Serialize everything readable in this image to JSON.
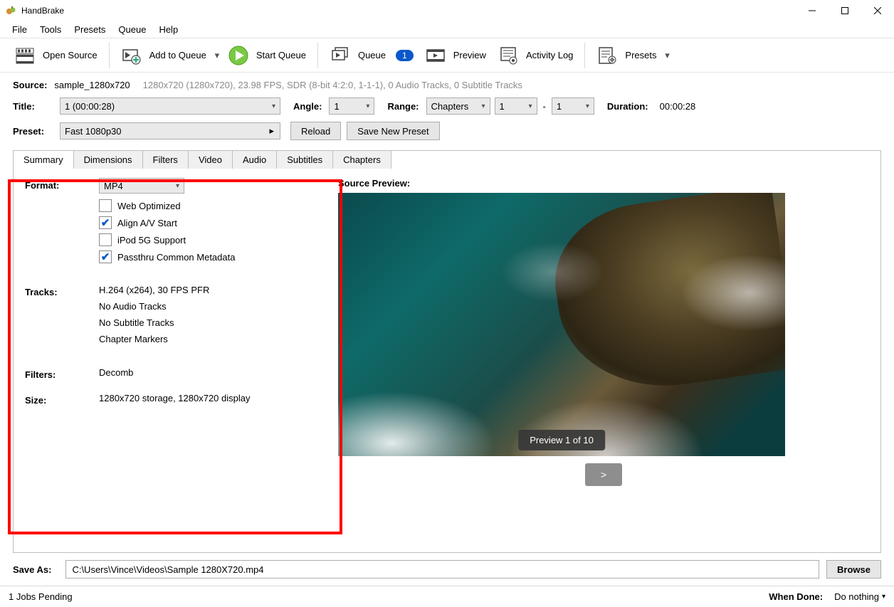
{
  "window": {
    "title": "HandBrake"
  },
  "menu": {
    "file": "File",
    "tools": "Tools",
    "presets": "Presets",
    "queue": "Queue",
    "help": "Help"
  },
  "toolbar": {
    "open_source": "Open Source",
    "add_to_queue": "Add to Queue",
    "start_queue": "Start Queue",
    "queue": "Queue",
    "queue_count": "1",
    "preview": "Preview",
    "activity_log": "Activity Log",
    "presets": "Presets"
  },
  "source": {
    "label": "Source:",
    "name": "sample_1280x720",
    "details": "1280x720 (1280x720), 23.98 FPS, SDR (8-bit 4:2:0, 1-1-1), 0 Audio Tracks, 0 Subtitle Tracks"
  },
  "title_row": {
    "title_label": "Title:",
    "title_value": "1  (00:00:28)",
    "angle_label": "Angle:",
    "angle_value": "1",
    "range_label": "Range:",
    "range_mode": "Chapters",
    "range_from": "1",
    "range_to": "1",
    "duration_label": "Duration:",
    "duration_value": "00:00:28"
  },
  "preset_row": {
    "label": "Preset:",
    "value": "Fast 1080p30",
    "reload": "Reload",
    "save_new": "Save New Preset"
  },
  "tabs": {
    "summary": "Summary",
    "dimensions": "Dimensions",
    "filters": "Filters",
    "video": "Video",
    "audio": "Audio",
    "subtitles": "Subtitles",
    "chapters": "Chapters"
  },
  "summary": {
    "format_label": "Format:",
    "format_value": "MP4",
    "web_optimized": "Web Optimized",
    "align_av": "Align A/V Start",
    "ipod": "iPod 5G Support",
    "passthru": "Passthru Common Metadata",
    "tracks_label": "Tracks:",
    "track_video": "H.264 (x264), 30 FPS PFR",
    "track_audio": "No Audio Tracks",
    "track_subs": "No Subtitle Tracks",
    "track_chapters": "Chapter Markers",
    "filters_label": "Filters:",
    "filters_value": "Decomb",
    "size_label": "Size:",
    "size_value": "1280x720 storage, 1280x720 display"
  },
  "preview": {
    "title": "Source Preview:",
    "badge": "Preview 1 of 10",
    "next": ">"
  },
  "save": {
    "label": "Save As:",
    "path": "C:\\Users\\Vince\\Videos\\Sample 1280X720.mp4",
    "browse": "Browse"
  },
  "status": {
    "left": "1 Jobs Pending",
    "when_done_label": "When Done:",
    "when_done_value": "Do nothing"
  }
}
